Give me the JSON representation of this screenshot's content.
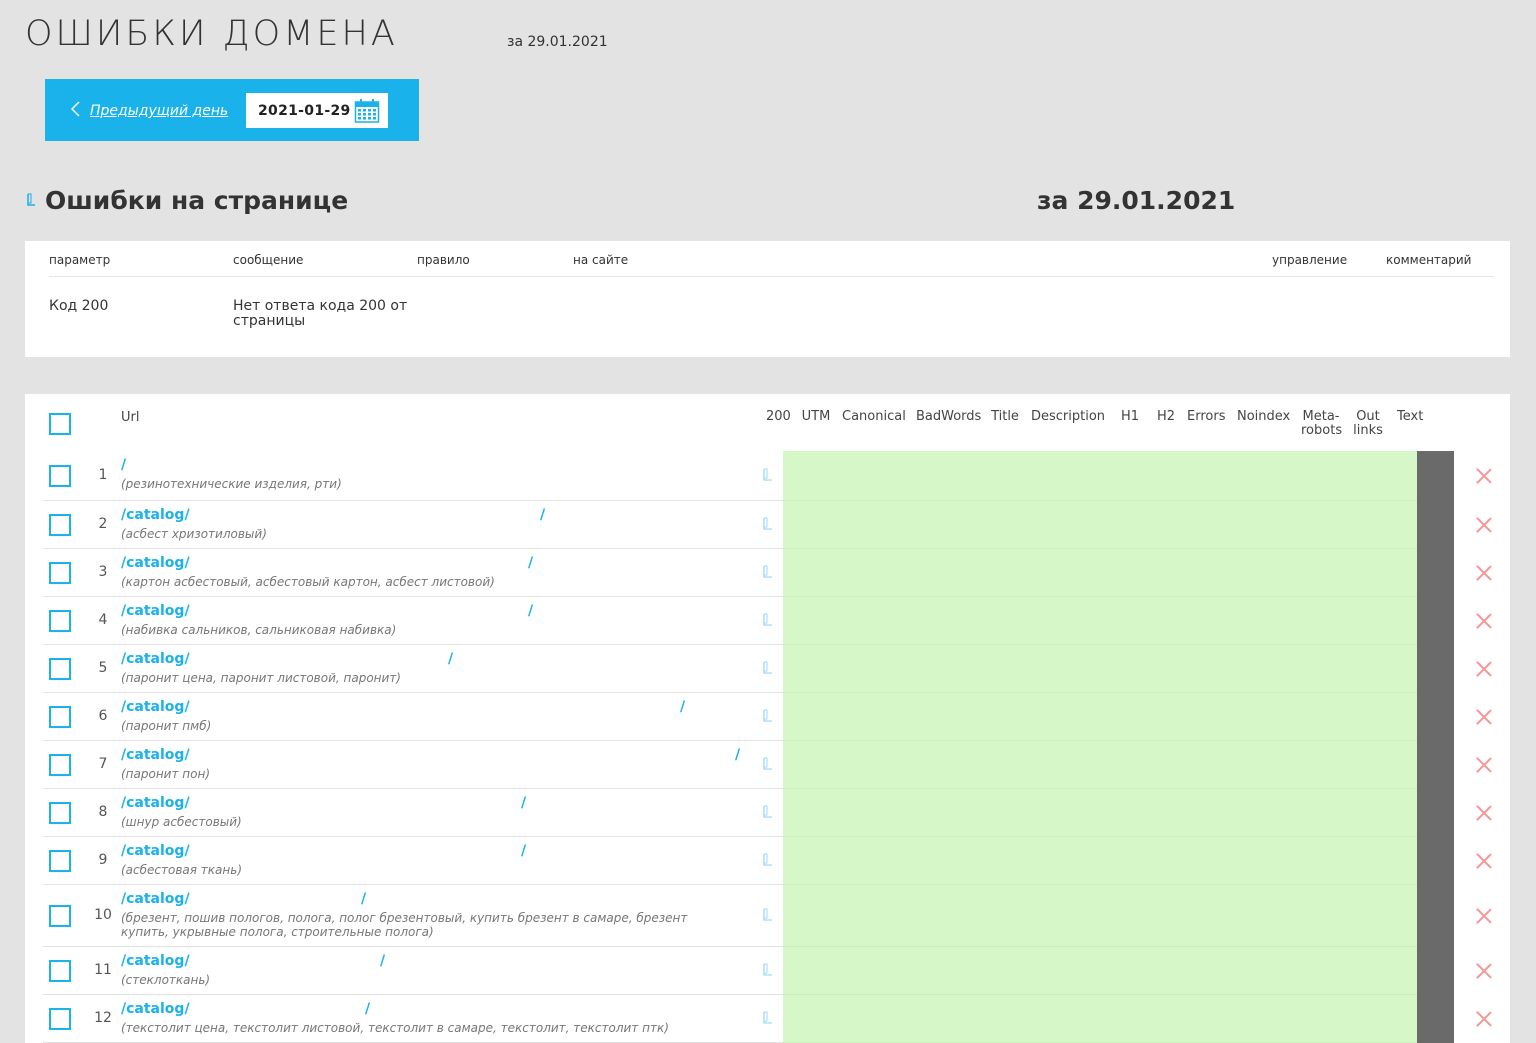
{
  "header": {
    "title": "ОШИБКИ ДОМЕНА",
    "date_caption": "за 29.01.2021"
  },
  "nav": {
    "prev_label": "Предыдущий день",
    "date_value": "2021-01-29",
    "icons": {
      "prev": "chevron-left-icon",
      "calendar": "calendar-icon"
    }
  },
  "section": {
    "title": "Ошибки на странице",
    "date": "за 29.01.2021"
  },
  "errors": {
    "headers": {
      "param": "параметр",
      "message": "сообщение",
      "rule": "правило",
      "on_site": "на сайте",
      "manage": "управление",
      "comment": "комментарий"
    },
    "row": {
      "param": "Код 200",
      "message": "Нет ответа кода 200 от страницы"
    }
  },
  "table": {
    "url_header": "Url",
    "columns": [
      "200",
      "UTM",
      "Canonical",
      "BadWords",
      "Title",
      "Description",
      "H1",
      "H2",
      "Errors",
      "Noindex",
      "Meta-robots",
      "Out links",
      "Text"
    ],
    "colors": {
      "accent": "#1ab2ea",
      "ok": "#d6f7c8",
      "text_col": "#6a6a6a",
      "delete": "#f29a9a"
    },
    "rows": [
      {
        "n": "1",
        "url": "/",
        "slash": "",
        "keywords": "(резинотехнические изделия, рти)"
      },
      {
        "n": "2",
        "url": "/catalog/",
        "slash": "/",
        "keywords": "(асбест хризотиловый)"
      },
      {
        "n": "3",
        "url": "/catalog/",
        "slash": "/",
        "keywords": "(картон асбестовый, асбестовый картон, асбест листовой)"
      },
      {
        "n": "4",
        "url": "/catalog/",
        "slash": "/",
        "keywords": "(набивка сальников, сальниковая набивка)"
      },
      {
        "n": "5",
        "url": "/catalog/",
        "slash": "/",
        "keywords": "(паронит цена, паронит листовой, паронит)"
      },
      {
        "n": "6",
        "url": "/catalog/",
        "slash": "/",
        "keywords": "(паронит пмб)"
      },
      {
        "n": "7",
        "url": "/catalog/",
        "slash": "/",
        "keywords": "(паронит пон)"
      },
      {
        "n": "8",
        "url": "/catalog/",
        "slash": "/",
        "keywords": "(шнур асбестовый)"
      },
      {
        "n": "9",
        "url": "/catalog/",
        "slash": "/",
        "keywords": "(асбестовая ткань)"
      },
      {
        "n": "10",
        "url": "/catalog/",
        "slash": "/",
        "keywords": "(брезент, пошив пологов, полога, полог брезентовый, купить брезент в самаре, брезент купить, укрывные полога, строительные полога)"
      },
      {
        "n": "11",
        "url": "/catalog/",
        "slash": "/",
        "keywords": "(стеклоткань)"
      },
      {
        "n": "12",
        "url": "/catalog/",
        "slash": "/",
        "keywords": "(текстолит цена, текстолит листовой, текстолит в самаре, текстолит, текстолит птк)"
      }
    ]
  }
}
